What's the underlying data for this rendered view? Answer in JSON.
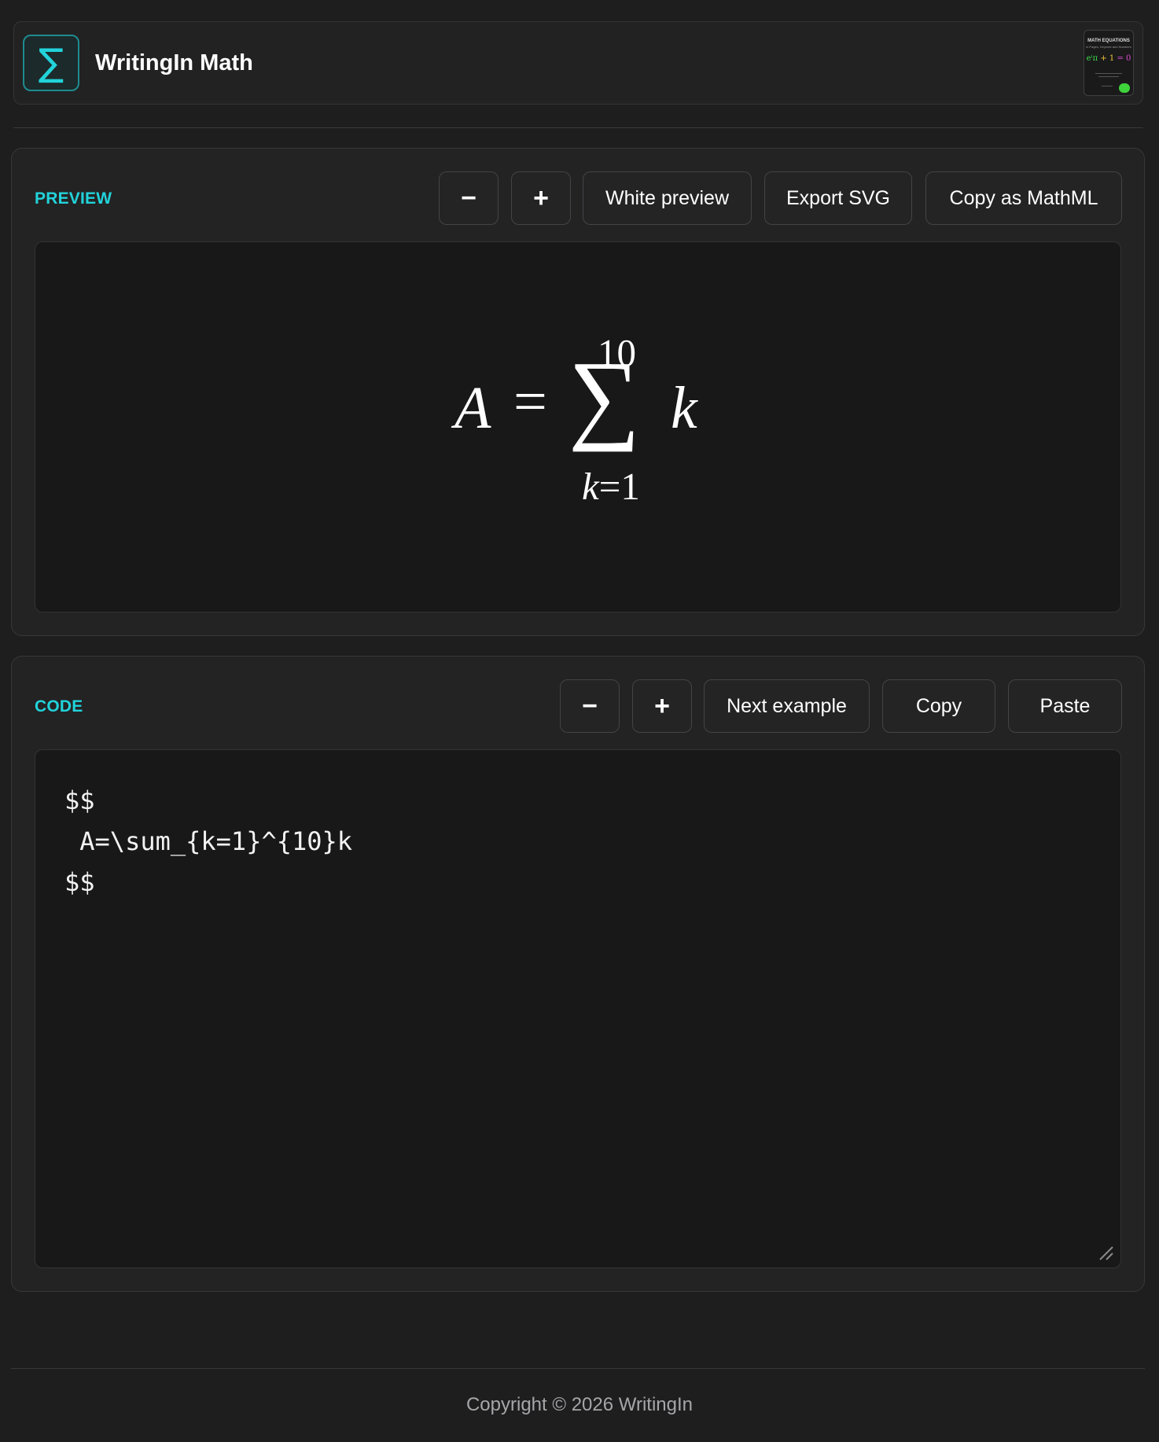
{
  "header": {
    "logo_glyph": "∑",
    "title": "WritingIn Math",
    "thumbnail": {
      "title": "MATH EQUATIONS",
      "subtitle": "in Pages, Keynote and Numbers",
      "equation": {
        "e": "eⁱπ",
        "plus": " + 1 ",
        "zero": "= 0"
      }
    }
  },
  "preview": {
    "label": "PREVIEW",
    "zoom_out_label": "−",
    "zoom_in_label": "+",
    "white_preview_label": "White preview",
    "export_svg_label": "Export SVG",
    "copy_mathml_label": "Copy as MathML",
    "formula": {
      "lhs": "A",
      "equals": "=",
      "operator": "∑",
      "upper": "10",
      "lower_var": "k",
      "lower_rest": "=1",
      "summand": "k"
    }
  },
  "code": {
    "label": "CODE",
    "zoom_out_label": "−",
    "zoom_in_label": "+",
    "next_example_label": "Next example",
    "copy_label": "Copy",
    "paste_label": "Paste",
    "value": "$$\n A=\\sum_{k=1}^{10}k\n$$"
  },
  "footer": {
    "copyright": "Copyright © 2026 WritingIn"
  },
  "colors": {
    "accent": "#22d3da",
    "background": "#1e1e1f",
    "panel": "#232324",
    "editor": "#181818"
  }
}
